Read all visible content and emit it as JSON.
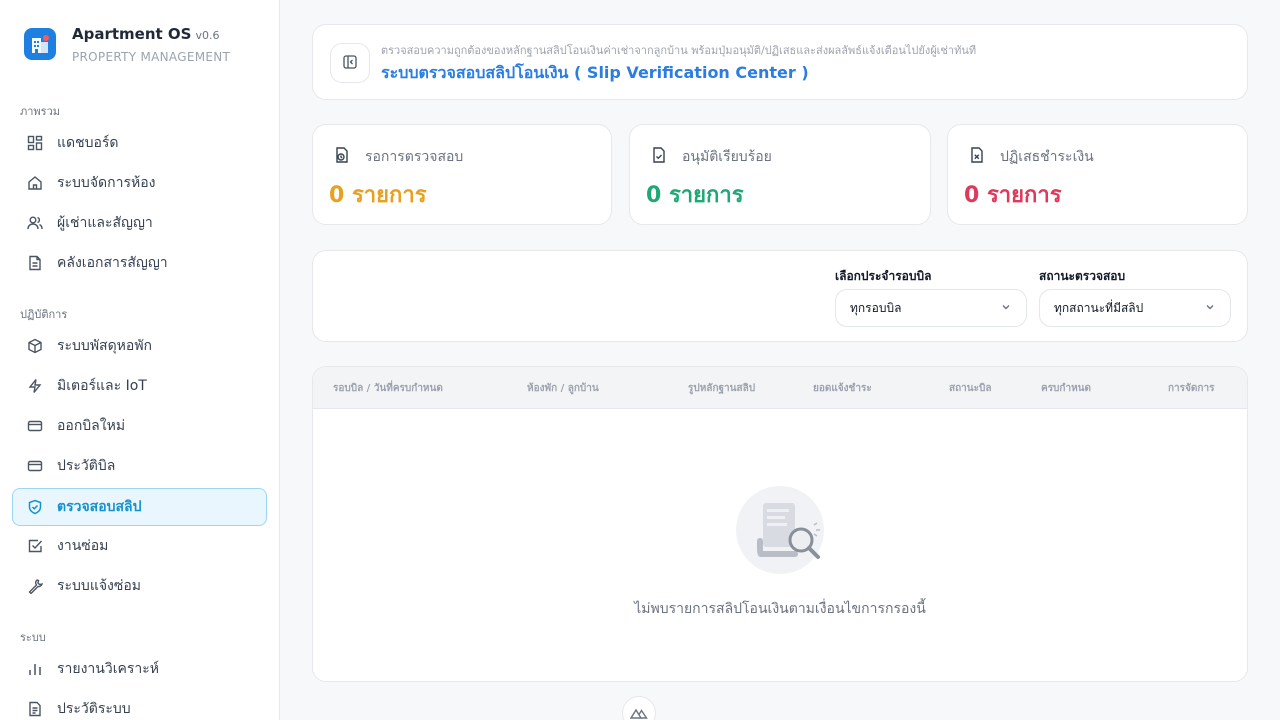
{
  "brand": {
    "title": "Apartment OS",
    "version": "v0.6",
    "subtitle": "PROPERTY MANAGEMENT"
  },
  "sidebar": {
    "sections": [
      {
        "label": "ภาพรวม",
        "items": [
          {
            "label": "แดชบอร์ด",
            "icon": "dashboard-icon"
          },
          {
            "label": "ระบบจัดการห้อง",
            "icon": "home-icon"
          },
          {
            "label": "ผู้เช่าและสัญญา",
            "icon": "users-icon"
          },
          {
            "label": "คลังเอกสารสัญญา",
            "icon": "document-icon"
          }
        ]
      },
      {
        "label": "ปฏิบัติการ",
        "items": [
          {
            "label": "ระบบพัสดุหอพัก",
            "icon": "package-icon"
          },
          {
            "label": "มิเตอร์และ IoT",
            "icon": "lightning-icon"
          },
          {
            "label": "ออกบิลใหม่",
            "icon": "card-icon"
          },
          {
            "label": "ประวัติบิล",
            "icon": "card-icon"
          },
          {
            "label": "ตรวจสอบสลิป",
            "icon": "shield-check-icon",
            "active": true
          },
          {
            "label": "งานซ่อม",
            "icon": "check-square-icon"
          },
          {
            "label": "ระบบแจ้งซ่อม",
            "icon": "wrench-icon"
          }
        ]
      },
      {
        "label": "ระบบ",
        "items": [
          {
            "label": "รายงานวิเคราะห์",
            "icon": "bar-chart-icon"
          },
          {
            "label": "ประวัติระบบ",
            "icon": "log-icon"
          }
        ]
      }
    ]
  },
  "header": {
    "description": "ตรวจสอบความถูกต้องของหลักฐานสลิปโอนเงินค่าเช่าจากลูกบ้าน พร้อมปุ่มอนุมัติ/ปฏิเสธและส่งผลลัพธ์แจ้งเตือนไปยังผู้เช่าทันที",
    "title": "ระบบตรวจสอบสลิปโอนเงิน ( Slip Verification Center )"
  },
  "stats": [
    {
      "label": "รอการตรวจสอบ",
      "value": "0 รายการ",
      "color": "#e8a021",
      "icon": "pending-file-icon"
    },
    {
      "label": "อนุมัติเรียบร้อย",
      "value": "0 รายการ",
      "color": "#1fa775",
      "icon": "approved-file-icon"
    },
    {
      "label": "ปฏิเสธชำระเงิน",
      "value": "0 รายการ",
      "color": "#e0385a",
      "icon": "rejected-file-icon"
    }
  ],
  "filters": {
    "billing_cycle": {
      "label": "เลือกประจำรอบบิล",
      "value": "ทุกรอบบิล"
    },
    "status": {
      "label": "สถานะตรวจสอบ",
      "value": "ทุกสถานะที่มีสลิป"
    }
  },
  "table": {
    "columns": [
      "รอบบิล / วันที่ครบกำหนด",
      "ห้องพัก / ลูกบ้าน",
      "รูปหลักฐานสลิป",
      "ยอดแจ้งชำระ",
      "สถานะบิล",
      "ครบกำหนด",
      "การจัดการ"
    ],
    "empty_message": "ไม่พบรายการสลิปโอนเงินตามเงื่อนไขการกรองนี้"
  },
  "colors": {
    "accent": "#2b7de0",
    "active_nav": "#1592cc",
    "pending": "#e8a021",
    "approved": "#1fa775",
    "rejected": "#e0385a"
  }
}
